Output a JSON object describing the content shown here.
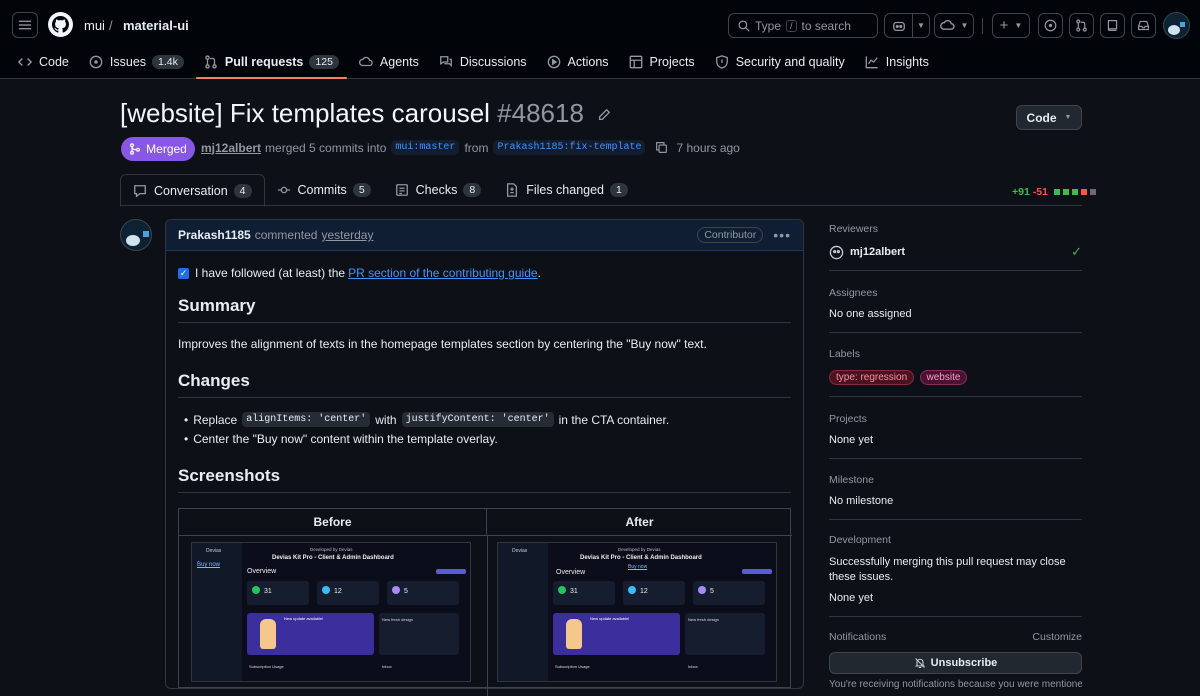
{
  "header": {
    "owner": "mui",
    "separator": "/",
    "repo": "material-ui",
    "search_label": "Type",
    "search_key": "/",
    "search_suffix": "to search"
  },
  "repo_tabs": [
    {
      "label": "Code",
      "count": ""
    },
    {
      "label": "Issues",
      "count": "1.4k"
    },
    {
      "label": "Pull requests",
      "count": "125"
    },
    {
      "label": "Agents",
      "count": ""
    },
    {
      "label": "Discussions",
      "count": ""
    },
    {
      "label": "Actions",
      "count": ""
    },
    {
      "label": "Projects",
      "count": ""
    },
    {
      "label": "Security and quality",
      "count": ""
    },
    {
      "label": "Insights",
      "count": ""
    }
  ],
  "pr": {
    "title": "[website] Fix templates carousel",
    "number": "#48618",
    "code_button": "Code",
    "state": "Merged",
    "author": "mj12albert",
    "merge_text": "merged 5 commits into",
    "base_branch": "mui:master",
    "from_text": "from",
    "head_branch": "Prakash1185:fix-template",
    "time": "7 hours ago",
    "additions": "+91",
    "deletions": "-51"
  },
  "pr_tabs": [
    {
      "label": "Conversation",
      "count": "4"
    },
    {
      "label": "Commits",
      "count": "5"
    },
    {
      "label": "Checks",
      "count": "8"
    },
    {
      "label": "Files changed",
      "count": "1"
    }
  ],
  "comment": {
    "author": "Prakash1185",
    "action": "commented",
    "time": "yesterday",
    "role_badge": "Contributor",
    "checkbox_text_pre": "I have followed (at least) the",
    "checkbox_link": "PR section of the contributing guide",
    "checkbox_text_post": ".",
    "h_summary": "Summary",
    "summary": "Improves the alignment of texts in the homepage templates section by centering the \"Buy now\" text.",
    "h_changes": "Changes",
    "change1_pre": "Replace",
    "change1_code1": "alignItems: 'center'",
    "change1_mid": "with",
    "change1_code2": "justifyContent: 'center'",
    "change1_post": "in the CTA container.",
    "change2": "Center the \"Buy now\" content within the template overlay.",
    "h_screenshots": "Screenshots",
    "col_before": "Before",
    "col_after": "After",
    "shot": {
      "brand": "Devias",
      "dev_by": "Developed by Devias",
      "product": "Devias Kit Pro - Client & Admin Dashboard",
      "buy_now": "Buy now",
      "overview": "Overview",
      "stat1": "31",
      "stat2": "12",
      "stat3": "5",
      "card_title": "New update available!",
      "card2_title": "New fresh design",
      "sub_title": "Subscription Usage",
      "inbox": "Inbox"
    }
  },
  "sidebar": {
    "reviewers_h": "Reviewers",
    "reviewer": "mj12albert",
    "assignees_h": "Assignees",
    "assignees": "No one assigned",
    "labels_h": "Labels",
    "label1": "type: regression",
    "label2": "website",
    "projects_h": "Projects",
    "projects": "None yet",
    "milestone_h": "Milestone",
    "milestone": "No milestone",
    "development_h": "Development",
    "development": "Successfully merging this pull request may close these issues.",
    "development_none": "None yet",
    "notifications_h": "Notifications",
    "customize": "Customize",
    "unsubscribe": "Unsubscribe",
    "notif_text": "You're receiving notifications because you were mentioned."
  },
  "colors": {
    "accent_tab": "#f78166",
    "merged": "#8957e5",
    "link": "#4493f8",
    "additions": "#3fb950",
    "deletions": "#f85149"
  }
}
